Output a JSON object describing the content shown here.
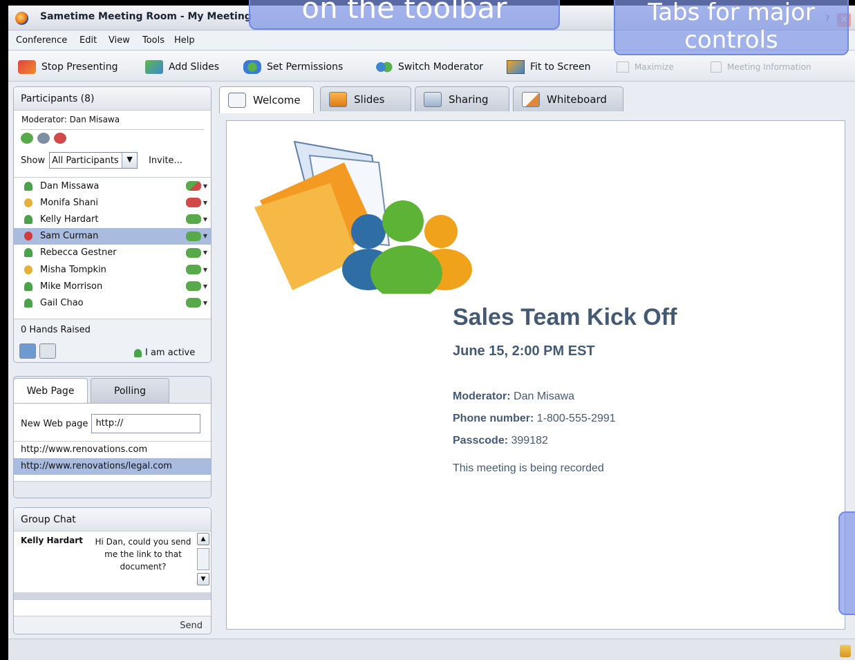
{
  "window": {
    "title": "Sametime Meeting Room - My Meeting"
  },
  "menu": [
    "Conference",
    "Edit",
    "View",
    "Tools",
    "Help"
  ],
  "toolbar": {
    "stop_presenting": "Stop Presenting",
    "add_slides": "Add Slides",
    "set_permissions": "Set Permissions",
    "switch_moderator": "Switch Moderator",
    "fit_to_screen": "Fit to Screen",
    "maximize": "Maximize",
    "meeting_information": "Meeting Information"
  },
  "participants": {
    "header": "Participants  (8)",
    "moderator_line": "Moderator:  Dan Misawa",
    "show_label": "Show",
    "show_value": "All Participants",
    "invite": "Invite...",
    "list": [
      {
        "name": "Dan Missawa",
        "status": "active",
        "action": "no-audio",
        "selected": false
      },
      {
        "name": "Monifa Shani",
        "status": "away",
        "action": "muted",
        "selected": false
      },
      {
        "name": "Kelly Hardart",
        "status": "active",
        "action": "audio",
        "selected": false
      },
      {
        "name": "Sam Curman",
        "status": "do-not-disturb",
        "action": "audio",
        "selected": true
      },
      {
        "name": "Rebecca Gestner",
        "status": "active",
        "action": "audio",
        "selected": false
      },
      {
        "name": "Misha Tompkin",
        "status": "away",
        "action": "audio",
        "selected": false
      },
      {
        "name": "Mike Morrison",
        "status": "active",
        "action": "audio",
        "selected": false
      },
      {
        "name": "Gail Chao",
        "status": "active",
        "action": "audio",
        "selected": false
      }
    ],
    "hands_raised": "0 Hands Raised",
    "self_status": "I am active"
  },
  "webpage": {
    "tabs": [
      "Web Page",
      "Polling"
    ],
    "label": "New Web page",
    "input_value": "http://",
    "links": [
      "http://www.renovations.com",
      "http://www.renovations/legal.com"
    ]
  },
  "chat": {
    "header": "Group Chat",
    "author": "Kelly Hardart",
    "message": "Hi Dan, could you send me the link to that document?",
    "send": "Send"
  },
  "main": {
    "tabs": [
      "Welcome",
      "Slides",
      "Sharing",
      "Whiteboard"
    ],
    "meeting_title": "Sales Team Kick Off",
    "meeting_date": "June 15, 2:00 PM EST",
    "moderator_label": "Moderator:",
    "moderator_value": "Dan Misawa",
    "phone_label": "Phone number:",
    "phone_value": "1-800-555-2991",
    "passcode_label": "Passcode:",
    "passcode_value": "399182",
    "recording_note": "This meeting is being recorded"
  },
  "callouts": {
    "toolbar_note": "on the toolbar",
    "tabs_note": "Tabs for major controls"
  },
  "colors": {
    "accent_blue": "#a9bce0",
    "heading_text": "#445a74",
    "callout": "#8096e6"
  }
}
